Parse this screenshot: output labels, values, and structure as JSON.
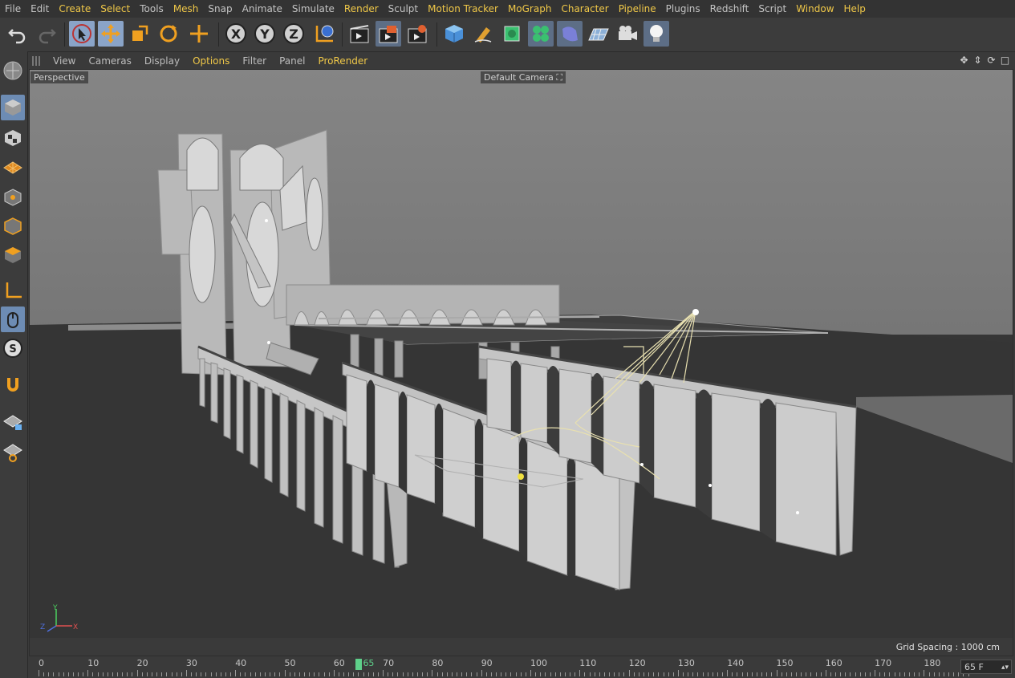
{
  "menubar": {
    "items": [
      {
        "label": "File",
        "hl": false
      },
      {
        "label": "Edit",
        "hl": false
      },
      {
        "label": "Create",
        "hl": true
      },
      {
        "label": "Select",
        "hl": true
      },
      {
        "label": "Tools",
        "hl": false
      },
      {
        "label": "Mesh",
        "hl": true
      },
      {
        "label": "Snap",
        "hl": false
      },
      {
        "label": "Animate",
        "hl": false
      },
      {
        "label": "Simulate",
        "hl": false
      },
      {
        "label": "Render",
        "hl": true
      },
      {
        "label": "Sculpt",
        "hl": false
      },
      {
        "label": "Motion Tracker",
        "hl": true
      },
      {
        "label": "MoGraph",
        "hl": true
      },
      {
        "label": "Character",
        "hl": true
      },
      {
        "label": "Pipeline",
        "hl": true
      },
      {
        "label": "Plugins",
        "hl": false
      },
      {
        "label": "Redshift",
        "hl": false
      },
      {
        "label": "Script",
        "hl": false
      },
      {
        "label": "Window",
        "hl": true
      },
      {
        "label": "Help",
        "hl": true
      }
    ]
  },
  "toolbar": {
    "icons": [
      "undo-icon",
      "redo-icon",
      "live-selection-icon",
      "move-icon",
      "scale-icon",
      "rotate-icon",
      "recent-tools-icon",
      "x-axis-icon",
      "y-axis-icon",
      "z-axis-icon",
      "coordinate-system-icon",
      "render-view-icon",
      "render-picture-viewer-icon",
      "render-settings-icon",
      "cube-icon",
      "pen-icon",
      "subdivision-icon",
      "cloner-icon",
      "deformer-icon",
      "floor-icon",
      "camera-icon",
      "light-icon"
    ],
    "axis_labels": {
      "x": "X",
      "y": "Y",
      "z": "Z"
    }
  },
  "viewport_menu": {
    "items": [
      {
        "label": "View",
        "hl": false
      },
      {
        "label": "Cameras",
        "hl": false
      },
      {
        "label": "Display",
        "hl": false
      },
      {
        "label": "Options",
        "hl": true
      },
      {
        "label": "Filter",
        "hl": false
      },
      {
        "label": "Panel",
        "hl": false
      },
      {
        "label": "ProRender",
        "hl": true
      }
    ]
  },
  "viewport": {
    "projection_label": "Perspective",
    "camera_label": "Default Camera",
    "grid_spacing": "Grid Spacing : 1000 cm",
    "axis": {
      "x": "X",
      "y": "Y",
      "z": "Z"
    }
  },
  "timeline": {
    "labels": [
      "0",
      "10",
      "20",
      "30",
      "40",
      "50",
      "60",
      "70",
      "80",
      "90",
      "100",
      "110",
      "120",
      "130",
      "140",
      "150",
      "160",
      "170",
      "180"
    ],
    "current_frame": "65",
    "frame_field": "65 F"
  },
  "colors": {
    "accent": "#f0c848",
    "active_tool": "#8aa4c8",
    "timeline_marker": "#5ed08a"
  }
}
